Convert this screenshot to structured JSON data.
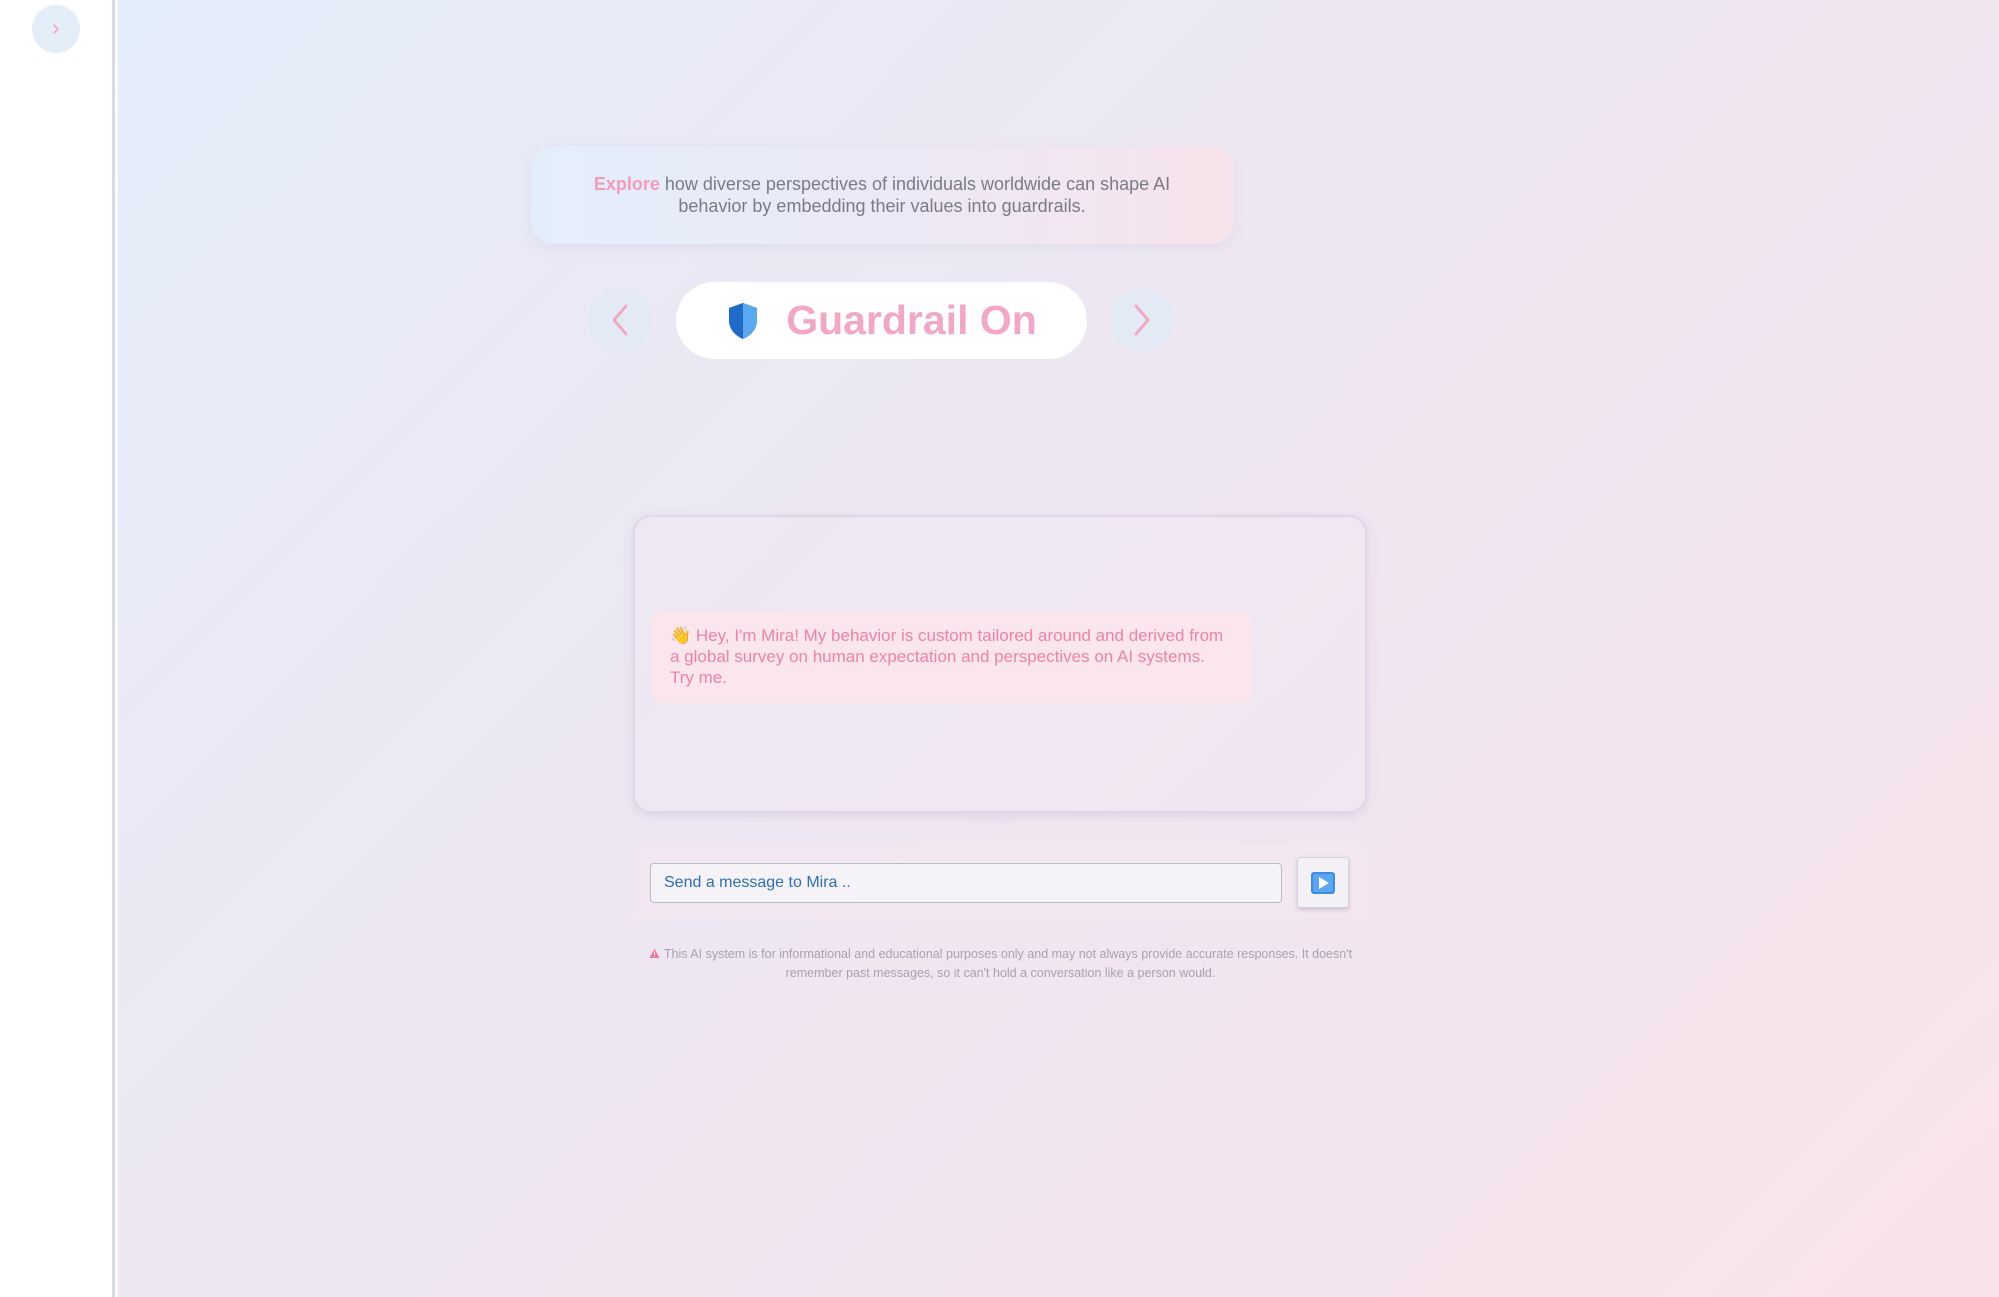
{
  "sidebar": {
    "toggle_icon": "chevron-right-icon"
  },
  "intro": {
    "accent_word": "Explore",
    "text": "how diverse perspectives of individuals worldwide can shape AI behavior by embedding their values into guardrails."
  },
  "guardrail": {
    "label": "Guardrail On",
    "icon": "shield-icon",
    "prev_icon": "chevron-left-icon",
    "next_icon": "chevron-right-icon"
  },
  "chat": {
    "greeting_emoji": "👋",
    "greeting": "Hey, I'm Mira! My behavior is custom tailored around and derived from a global survey on human expectation and perspectives on AI systems. Try me."
  },
  "composer": {
    "placeholder": "Send a message to Mira ..",
    "send_icon": "play-icon"
  },
  "disclaimer": {
    "icon": "warning-icon",
    "text": "This AI system is for informational and educational purposes only and may not always provide accurate responses. It doesn't remember past messages, so it can't hold a conversation like a person would."
  },
  "colors": {
    "accent_pink": "#f2a8c5",
    "bubble_text": "#ee82aa",
    "input_text": "#2f6fb4"
  }
}
